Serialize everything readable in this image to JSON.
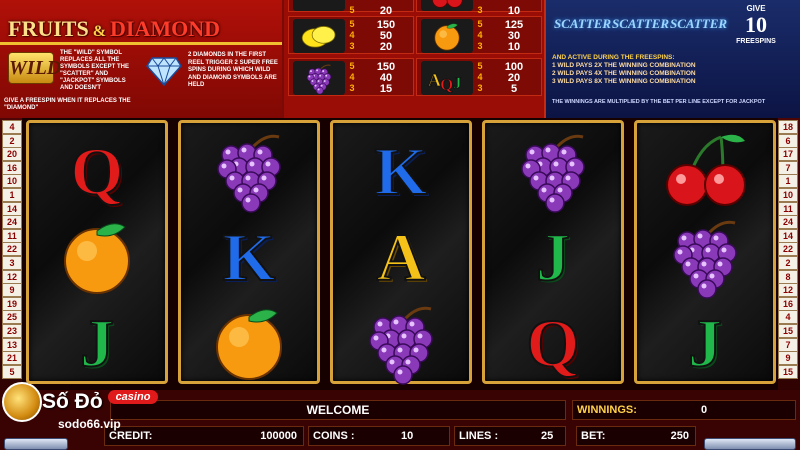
{
  "title": {
    "left": "FRUITS",
    "amp": "&",
    "right": "DIAMOND"
  },
  "wild": {
    "logo": "WILD",
    "text": "THE \"WILD\" SYMBOL REPLACES ALL THE SYMBOLS EXCEPT THE \"SCATTER\" AND \"JACKPOT\" SYMBOLS AND DOESN'T",
    "text2": "GIVE A FREESPIN WHEN IT REPLACES THE \"DIAMOND\""
  },
  "diamond": {
    "text": "2 DIAMONDS IN THE FIRST REEL TRIGGER 2 SUPER FREE SPINS DURING WHICH WILD AND DIAMOND SYMBOLS ARE HELD"
  },
  "paytable": {
    "left": [
      {
        "symbol": "melon-icon",
        "rows": [
          {
            "n": "5",
            "v": "20"
          }
        ]
      },
      {
        "symbol": "lemon-icon",
        "rows": [
          {
            "n": "5",
            "v": "150"
          },
          {
            "n": "4",
            "v": "50"
          },
          {
            "n": "3",
            "v": "20"
          }
        ]
      },
      {
        "symbol": "grapes-icon",
        "rows": [
          {
            "n": "5",
            "v": "150"
          },
          {
            "n": "4",
            "v": "40"
          },
          {
            "n": "3",
            "v": "15"
          }
        ]
      }
    ],
    "right": [
      {
        "symbol": "cherry-icon",
        "rows": [
          {
            "n": "3",
            "v": "10"
          }
        ]
      },
      {
        "symbol": "orange-icon",
        "rows": [
          {
            "n": "5",
            "v": "125"
          },
          {
            "n": "4",
            "v": "30"
          },
          {
            "n": "3",
            "v": "10"
          }
        ]
      },
      {
        "symbol": "aqj-icon",
        "rows": [
          {
            "n": "5",
            "v": "100"
          },
          {
            "n": "4",
            "v": "20"
          },
          {
            "n": "3",
            "v": "5"
          }
        ]
      }
    ]
  },
  "scatter": {
    "labels": [
      "SCATTER",
      "SCATTER",
      "SCATTER"
    ],
    "give": "GIVE",
    "count": "10",
    "freespins": "FREESPINS",
    "active": "AND ACTIVE DURING THE FREESPINS:",
    "rules": [
      "1 WILD PAYS 2x THE WINNING COMBINATION",
      "2 WILD PAYS 4x THE WINNING COMBINATION",
      "3 WILD PAYS 8x THE WINNING COMBINATION"
    ],
    "note": "THE WINNINGS ARE MULTIPLIED BY THE BET PER LINE EXCEPT FOR JACKPOT"
  },
  "paylines": {
    "left": [
      "4",
      "2",
      "20",
      "16",
      "10",
      "1",
      "14",
      "24",
      "11",
      "22",
      "3",
      "12",
      "9",
      "19",
      "25",
      "23",
      "13",
      "21",
      "5"
    ],
    "right": [
      "18",
      "6",
      "17",
      "7",
      "1",
      "10",
      "11",
      "24",
      "14",
      "22",
      "2",
      "8",
      "12",
      "16",
      "4",
      "15",
      "7",
      "9",
      "15"
    ]
  },
  "reels": [
    [
      "Q",
      "orange",
      "J"
    ],
    [
      "grapes",
      "K",
      "orange"
    ],
    [
      "K",
      "A",
      "grapes"
    ],
    [
      "grapes",
      "J",
      "Q"
    ],
    [
      "cherry",
      "grapes",
      "J"
    ]
  ],
  "status": {
    "message": "WELCOME",
    "winnings_label": "WINNINGS:",
    "winnings": "0",
    "credit_label": "CREDIT:",
    "credit": "100000",
    "coins_label": "COINS :",
    "coins": "10",
    "lines_label": "LINES :",
    "lines": "25",
    "bet_label": "BET:",
    "bet": "250"
  },
  "brand": {
    "name": "Số Đỏ",
    "tag": "casino",
    "url": "sodo66.vip"
  },
  "colors": {
    "q": "#e11a1a",
    "k": "#1f6bea",
    "a": "#f5c21a",
    "j": "#20b84a",
    "frame": "#d7a23a"
  }
}
